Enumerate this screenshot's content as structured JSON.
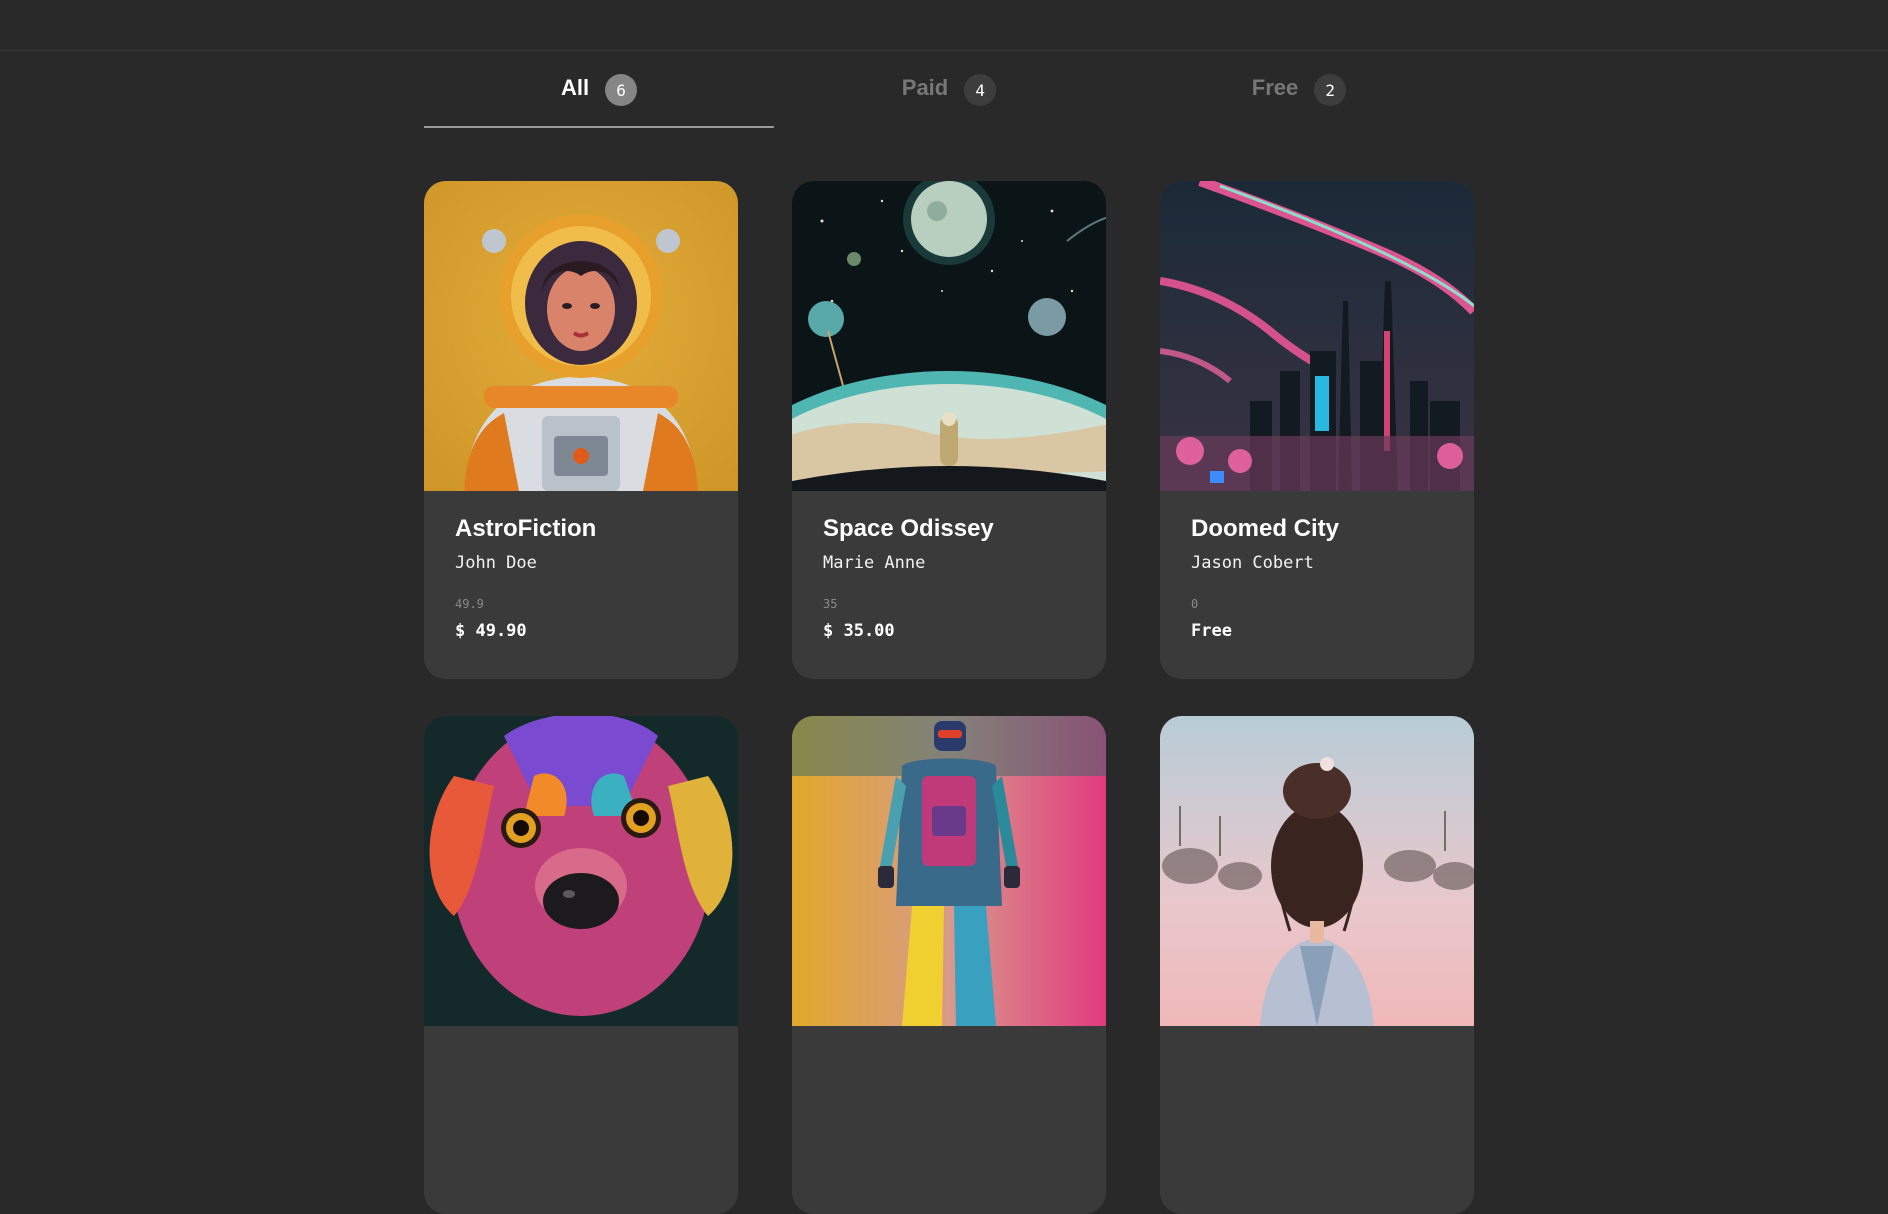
{
  "tabs": [
    {
      "label": "All",
      "count": "6",
      "active": true
    },
    {
      "label": "Paid",
      "count": "4",
      "active": false
    },
    {
      "label": "Free",
      "count": "2",
      "active": false
    }
  ],
  "cards": [
    {
      "title": "AstroFiction",
      "author": "John Doe",
      "raw_price": "49.9",
      "price": "$ 49.90"
    },
    {
      "title": "Space Odissey",
      "author": "Marie Anne",
      "raw_price": "35",
      "price": "$ 35.00"
    },
    {
      "title": "Doomed City",
      "author": "Jason Cobert",
      "raw_price": "0",
      "price": "Free"
    },
    {
      "title": "",
      "author": "",
      "raw_price": "",
      "price": ""
    },
    {
      "title": "",
      "author": "",
      "raw_price": "",
      "price": ""
    },
    {
      "title": "",
      "author": "",
      "raw_price": "",
      "price": ""
    }
  ],
  "colors": {
    "background": "#292929",
    "card": "#3a3a3a",
    "tab_inactive": "#777777",
    "tab_underline": "#9a9a9a"
  }
}
